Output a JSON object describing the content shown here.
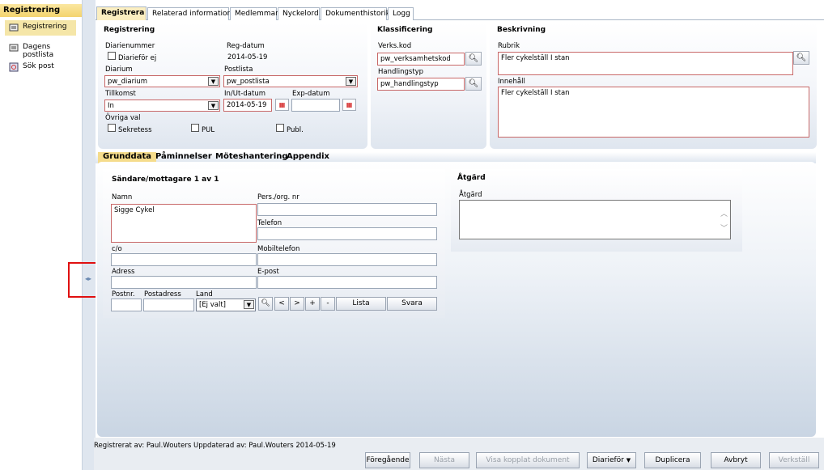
{
  "sidebar": {
    "title": "Registrering",
    "items": [
      {
        "label": "Registrering",
        "icon": "registry-icon"
      },
      {
        "label": "Dagens postlista",
        "icon": "postlist-icon"
      },
      {
        "label": "Sök post",
        "icon": "search-post-icon"
      }
    ]
  },
  "tabs": [
    "Registrera",
    "Relaterad information",
    "Medlemmar",
    "Nyckelord",
    "Dokumenthistorik",
    "Logg"
  ],
  "registrering": {
    "title": "Registrering",
    "diarienummer_label": "Diarienummer",
    "reg_datum_label": "Reg-datum",
    "reg_datum_value": "2014-05-19",
    "diariefor_ej_label": "Diarieför ej",
    "diarium_label": "Diarium",
    "diarium_value": "pw_diarium",
    "postlista_label": "Postlista",
    "postlista_value": "pw_postlista",
    "tillkomst_label": "Tillkomst",
    "tillkomst_value": "In",
    "in_ut_label": "In/Ut-datum",
    "in_ut_value": "2014-05-19",
    "exp_label": "Exp-datum",
    "exp_value": "",
    "ovriga_label": "Övriga val",
    "sekretess_label": "Sekretess",
    "pul_label": "PUL",
    "publ_label": "Publ."
  },
  "klassificering": {
    "title": "Klassificering",
    "verks_label": "Verks.kod",
    "verks_value": "pw_verksamhetskod",
    "handling_label": "Handlingstyp",
    "handling_value": "pw_handlingstyp"
  },
  "beskrivning": {
    "title": "Beskrivning",
    "rubrik_label": "Rubrik",
    "rubrik_value": "Fler cykelställ I stan",
    "innehall_label": "Innehåll",
    "innehall_value": "Fler cykelställ I stan"
  },
  "subtabs": [
    "Grunddata",
    "Påminnelser",
    "Möteshantering",
    "Appendix"
  ],
  "sender": {
    "title": "Sändare/mottagare 1 av 1",
    "namn_label": "Namn",
    "namn_value": "Sigge Cykel",
    "pers_label": "Pers./org. nr",
    "telefon_label": "Telefon",
    "co_label": "c/o",
    "mobil_label": "Mobiltelefon",
    "adress_label": "Adress",
    "epost_label": "E-post",
    "postnr_label": "Postnr.",
    "postadress_label": "Postadress",
    "land_label": "Land",
    "land_value": "[Ej valt]",
    "nav": [
      "<",
      ">",
      "+",
      "-"
    ],
    "lista_label": "Lista",
    "svara_label": "Svara"
  },
  "atgard": {
    "title": "Åtgärd",
    "field_label": "Åtgärd",
    "value": ""
  },
  "footer": {
    "status": "Registrerat av: Paul.Wouters   Uppdaterad av: Paul.Wouters 2014-05-19",
    "buttons": {
      "foregaende": "Föregående",
      "nasta": "Nästa",
      "visa": "Visa kopplat dokument",
      "diarifor": "Diarieför",
      "duplicera": "Duplicera",
      "avbryt": "Avbryt",
      "verkstall": "Verkställ"
    }
  },
  "colors": {
    "accent": "#f5dc8c",
    "panel": "#dfe6ef",
    "required_border": "#c86868",
    "highlight_box": "#e01010"
  }
}
